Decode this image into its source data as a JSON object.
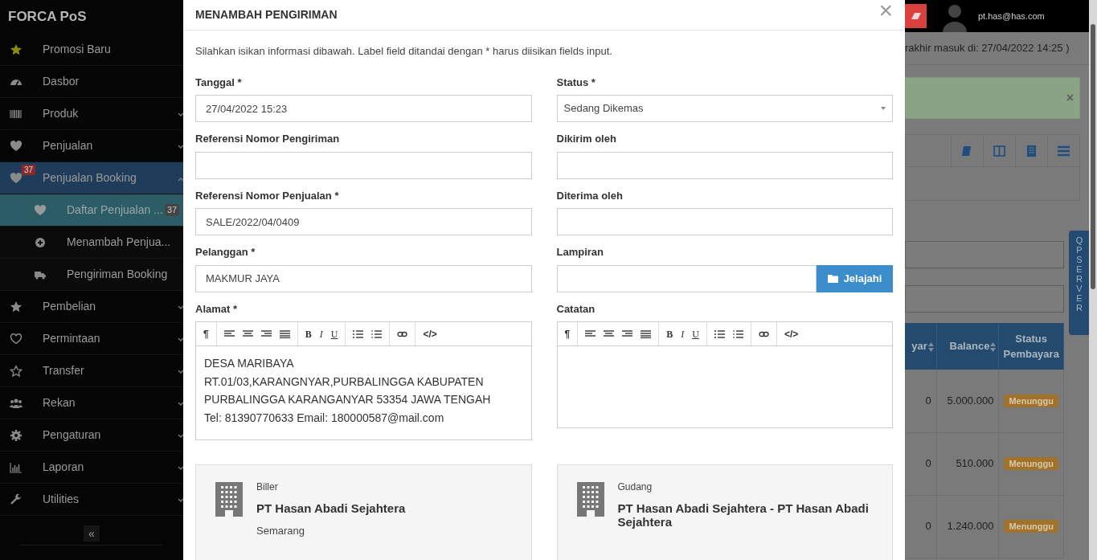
{
  "sidebar": {
    "brand": "FORCA PoS",
    "items": [
      {
        "label": "Promosi Baru",
        "selected": false
      },
      {
        "label": "Dasbor",
        "selected": false
      },
      {
        "label": "Produk",
        "selected": false,
        "expanded": false
      },
      {
        "label": "Penjualan",
        "selected": false,
        "expanded": false
      },
      {
        "label": "Penjualan Booking",
        "selected": true,
        "expanded": true,
        "badge": "37",
        "children": [
          {
            "label": "Daftar Penjualan ...",
            "selected": true,
            "badge": "37"
          },
          {
            "label": "Menambah Penjua...",
            "selected": false
          },
          {
            "label": "Pengiriman Booking",
            "selected": false
          }
        ]
      },
      {
        "label": "Pembelian",
        "selected": false,
        "expanded": false
      },
      {
        "label": "Permintaan",
        "selected": false,
        "expanded": false
      },
      {
        "label": "Transfer",
        "selected": false,
        "expanded": false
      },
      {
        "label": "Rekan",
        "selected": false,
        "expanded": false
      },
      {
        "label": "Pengaturan",
        "selected": false,
        "expanded": false
      },
      {
        "label": "Laporan",
        "selected": false,
        "expanded": false
      },
      {
        "label": "Utilities",
        "selected": false,
        "expanded": false
      }
    ],
    "collapse_button": "«"
  },
  "header": {
    "user_email": "pt.has@has.com"
  },
  "background": {
    "last_login": "rakhir masuk di: 27/04/2022 14:25 )",
    "alert_close": "×",
    "table": {
      "columns": [
        "yar",
        "Balance",
        "Status Pembayara"
      ],
      "rows": [
        [
          "0",
          "5.000.000",
          "Menunggu"
        ],
        [
          "0",
          "510.000",
          "Menunggu"
        ],
        [
          "0",
          "1.240.000",
          "Menunggu"
        ]
      ]
    },
    "side_tab": "QP SERVER"
  },
  "modal": {
    "title": "MENAMBAH PENGIRIMAN",
    "close": "×",
    "intro": "Silahkan isikan informasi dibawah. Label field ditandai dengan * harus diisikan fields input.",
    "fields": [
      {
        "kind": "text",
        "label": "Tanggal *",
        "value": "27/04/2022 15:23"
      },
      {
        "kind": "select",
        "label": "Status *",
        "value": "Sedang Dikemas"
      },
      {
        "kind": "text",
        "label": "Referensi Nomor Pengiriman"
      },
      {
        "kind": "text",
        "label": "Dikirim oleh"
      },
      {
        "kind": "text",
        "label": "Referensi Nomor Penjualan *",
        "value": "SALE/2022/04/0409"
      },
      {
        "kind": "text",
        "label": "Diterima oleh"
      },
      {
        "kind": "text",
        "label": "Pelanggan *",
        "value": "MAKMUR JAYA"
      },
      {
        "kind": "file",
        "label": "Lampiran",
        "button": "Jelajahi"
      },
      {
        "kind": "editor",
        "label": "Alamat *",
        "toolbar": {
          "paragraph": "¶",
          "bold": "B",
          "italic": "I",
          "underline": "U",
          "code": "</>"
        },
        "lines": [
          "DESA MARIBAYA",
          "RT.01/03,KARANGNYAR,PURBALINGGA KABUPATEN",
          "PURBALINGGA KARANGANYAR 53354 JAWA TENGAH",
          "Tel: 81390770633 Email: 180000587@mail.com"
        ]
      },
      {
        "kind": "editor",
        "label": "Catatan",
        "toolbar": {
          "paragraph": "¶",
          "bold": "B",
          "italic": "I",
          "underline": "U",
          "code": "</>"
        }
      }
    ],
    "cards": [
      {
        "label": "Biller",
        "name": "PT Hasan Abadi Sejahtera",
        "detail": "Semarang"
      },
      {
        "label": "Gudang",
        "name": "PT Hasan Abadi Sejahtera - PT Hasan Abadi Sejahtera"
      }
    ]
  }
}
